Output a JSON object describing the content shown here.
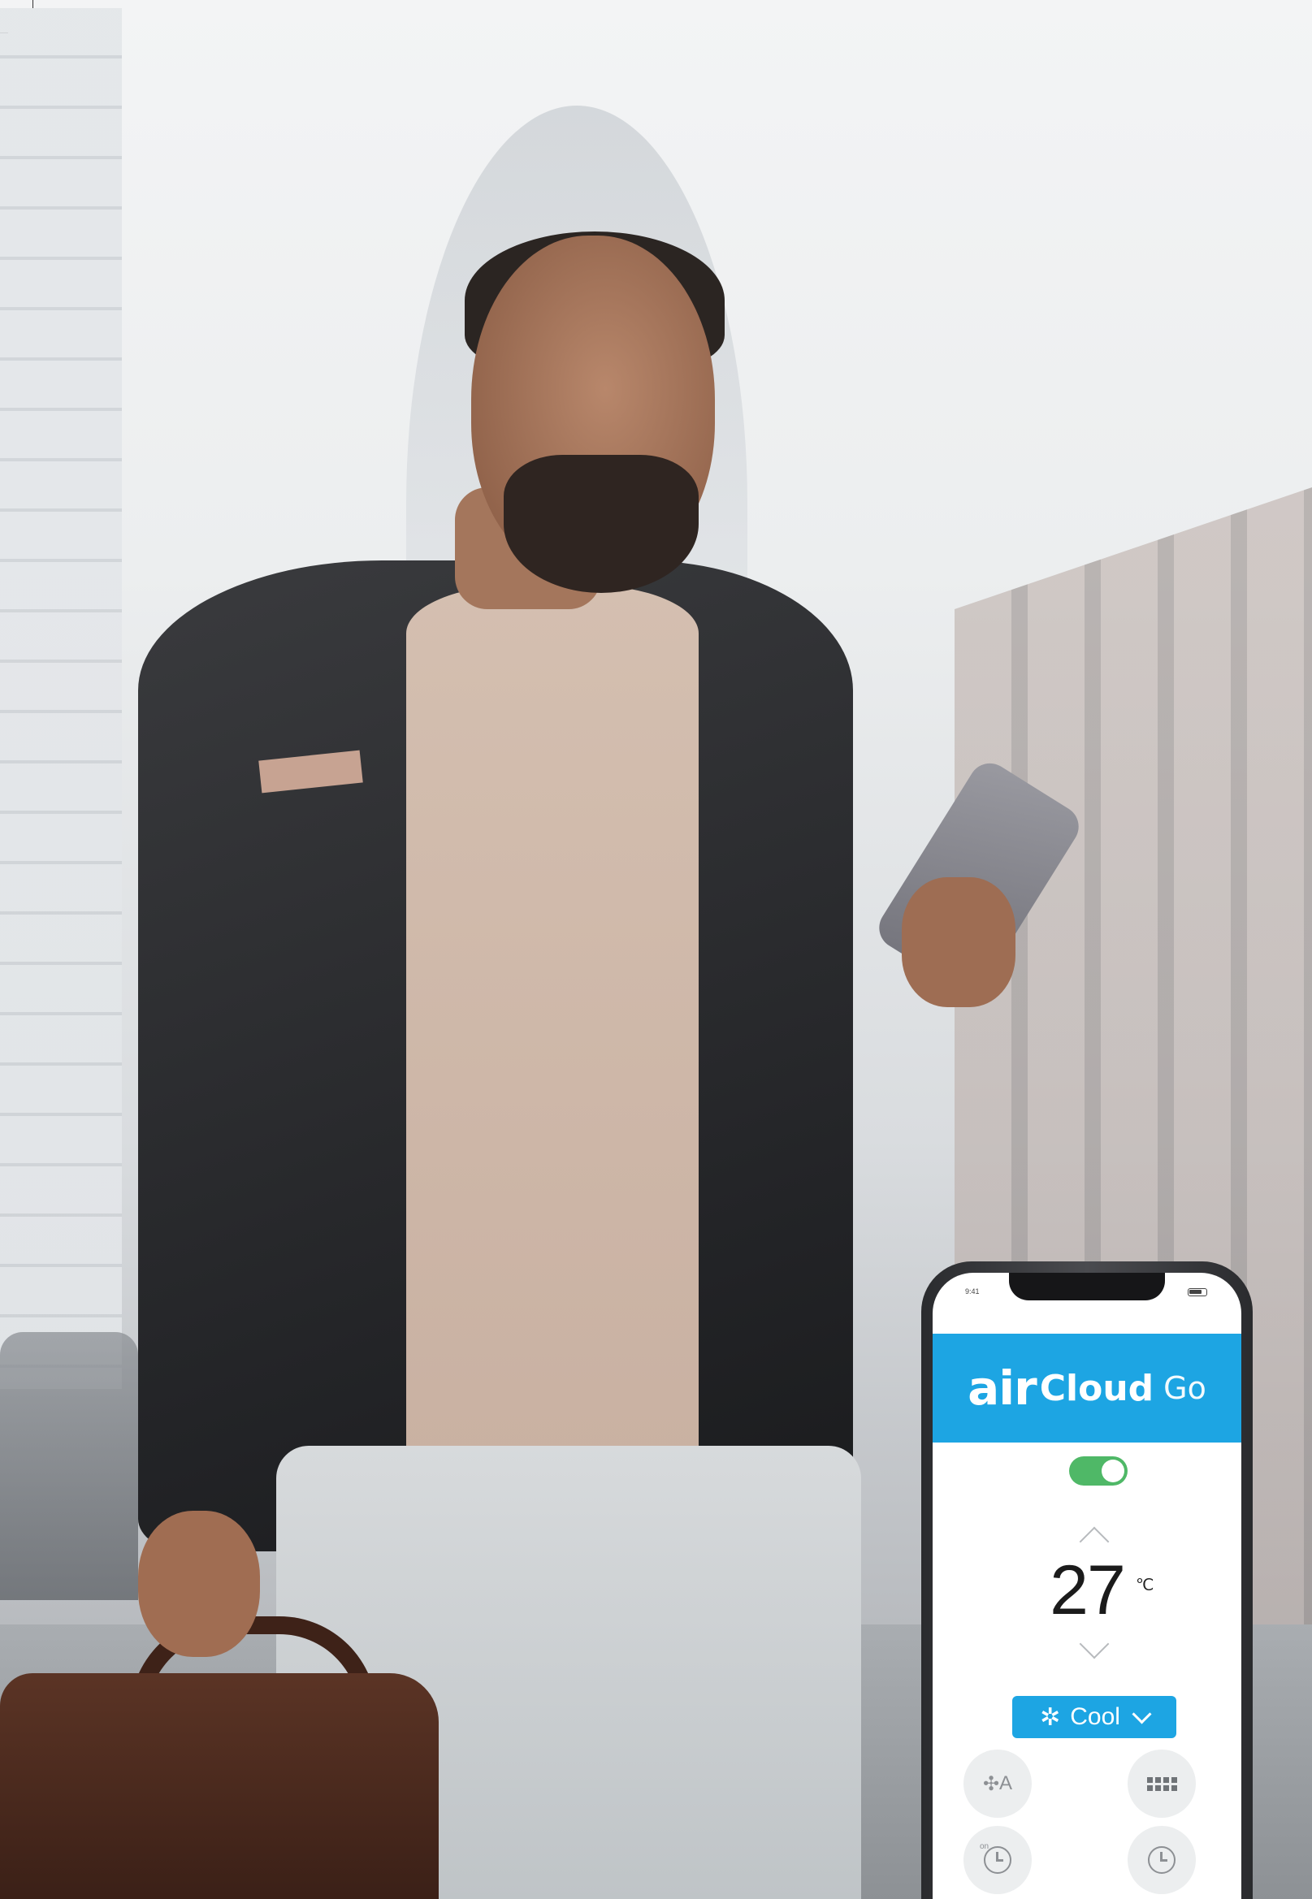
{
  "app": {
    "brand_air": "air",
    "brand_cloud": "Cloud",
    "brand_go": "Go",
    "status_time": "9:41"
  },
  "power": {
    "state": "on"
  },
  "temperature": {
    "value": "27",
    "unit": "℃"
  },
  "mode": {
    "label": "Cool",
    "icon": "snowflake-icon"
  },
  "controls": {
    "fan_label": "A",
    "fan_icon": "fan-icon",
    "grid_icon": "louver-grid-icon",
    "timer_on_icon": "timer-on-icon",
    "timer_icon": "timer-icon"
  },
  "colors": {
    "accent": "#1da5e3",
    "toggle_on": "#4fb867",
    "button_bg": "#eceeef"
  }
}
